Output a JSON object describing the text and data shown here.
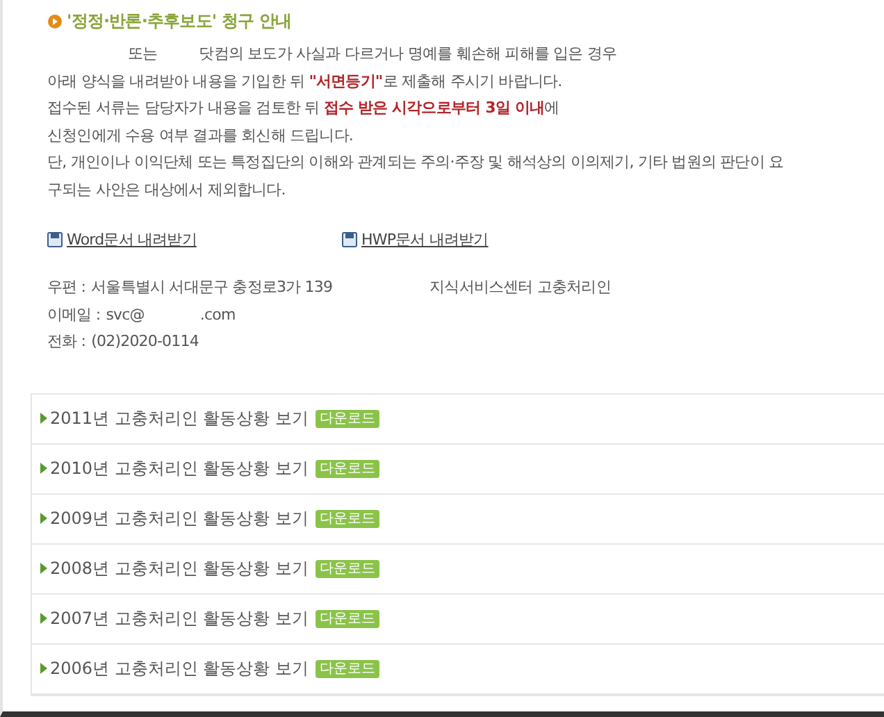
{
  "title": "'정정·반론·추후보도' 청구 안내",
  "paragraph_lines": [
    [
      {
        "text": "또는",
        "highlight": false
      },
      {
        "text": "닷컴의 보도가 사실과 다르거나 명예를 훼손해 피해를 입은 경우",
        "highlight": false
      }
    ],
    [
      {
        "text": "아래 양식을 내려받아 내용을 기입한 뒤 ",
        "highlight": false
      },
      {
        "text": "\"서면등기\"",
        "highlight": true
      },
      {
        "text": "로 제출해 주시기 바랍니다.",
        "highlight": false
      }
    ],
    [
      {
        "text": "접수된 서류는 담당자가 내용을 검토한 뒤 ",
        "highlight": false
      },
      {
        "text": "접수 받은 시각으로부터 3일 이내",
        "highlight": true
      },
      {
        "text": "에",
        "highlight": false
      }
    ],
    [
      {
        "text": "신청인에게 수용 여부 결과를 회신해 드립니다.",
        "highlight": false
      }
    ],
    [
      {
        "text": "단, 개인이나 이익단체 또는 특정집단의 이해와 관계되는 주의·주장 및 해석상의 이의제기, 기타 법원의 판단이 요",
        "highlight": false
      }
    ],
    [
      {
        "text": "구되는 사안은 대상에서 제외합니다.",
        "highlight": false
      }
    ]
  ],
  "download_links": [
    "Word문서 내려받기",
    "HWP문서 내려받기"
  ],
  "contact": [
    {
      "label": "우편 :",
      "value": "서울특별시 서대문구 충정로3가 139",
      "extra": "지식서비스센터 고충처리인"
    },
    {
      "label": "이메일 :",
      "value": "svc@",
      "extra": ".com"
    },
    {
      "label": "전화 :",
      "value": "(02)2020-0114"
    }
  ],
  "reports": [
    {
      "label": "2011년 고충처리인 활동상황 보기",
      "badge": "다운로드"
    },
    {
      "label": "2010년 고충처리인 활동상황 보기",
      "badge": "다운로드"
    },
    {
      "label": "2009년 고충처리인 활동상황 보기",
      "badge": "다운로드"
    },
    {
      "label": "2008년 고충처리인 활동상황 보기",
      "badge": "다운로드"
    },
    {
      "label": "2007년 고충처리인 활동상황 보기",
      "badge": "다운로드"
    },
    {
      "label": "2006년 고충처리인 활동상황 보기",
      "badge": "다운로드"
    }
  ]
}
